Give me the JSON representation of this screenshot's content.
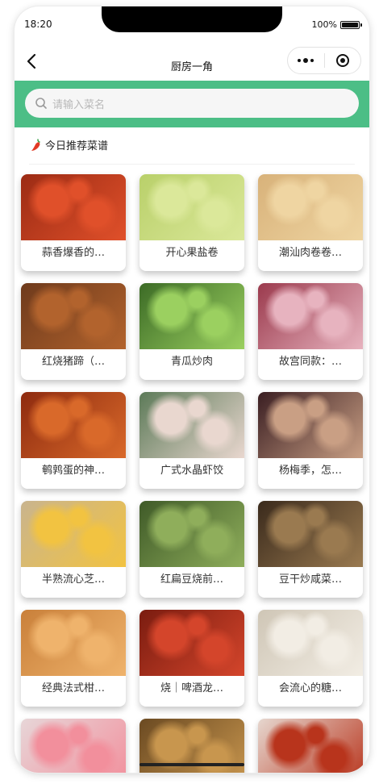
{
  "status": {
    "time": "18:20",
    "battery": "100%"
  },
  "nav": {
    "title": "厨房一角"
  },
  "search": {
    "placeholder": "请输入菜名"
  },
  "section": {
    "title": "今日推荐菜谱"
  },
  "colors": {
    "accent": "#4cbe86",
    "page_bg": "#ffffff"
  },
  "recipes": [
    {
      "label": "蒜香爆香的…",
      "bg": "#9b2b14",
      "accent": "#e0502a"
    },
    {
      "label": "开心果盐卷",
      "bg": "#b9d06a",
      "accent": "#dbe89a"
    },
    {
      "label": "潮汕肉卷卷…",
      "bg": "#d8b27a",
      "accent": "#efd5a2"
    },
    {
      "label": "红烧猪蹄（…",
      "bg": "#6e3a1c",
      "accent": "#b2632d"
    },
    {
      "label": "青瓜炒肉",
      "bg": "#3c6b26",
      "accent": "#9bd060"
    },
    {
      "label": "故宫同款：…",
      "bg": "#9b3a4d",
      "accent": "#e7b3bf"
    },
    {
      "label": "鹌鹑蛋的神…",
      "bg": "#8d2a0f",
      "accent": "#d9692a"
    },
    {
      "label": "广式水晶虾饺",
      "bg": "#5c7a58",
      "accent": "#e9d7cf"
    },
    {
      "label": "杨梅季，怎…",
      "bg": "#3a1e22",
      "accent": "#c99f84"
    },
    {
      "label": "半熟流心芝…",
      "bg": "#c9b48e",
      "accent": "#f2c341"
    },
    {
      "label": "红扁豆烧前…",
      "bg": "#3f5a28",
      "accent": "#8fae5b"
    },
    {
      "label": "豆干炒咸菜…",
      "bg": "#3a2a1c",
      "accent": "#9a7a50"
    },
    {
      "label": "经典法式柑…",
      "bg": "#c9803a",
      "accent": "#efb36c"
    },
    {
      "label": "烧｜啤酒龙…",
      "bg": "#7a1c10",
      "accent": "#d4452b"
    },
    {
      "label": "会流心的糖…",
      "bg": "#cfc6b6",
      "accent": "#f2ede4"
    },
    {
      "label": "",
      "bg": "#e7d6d8",
      "accent": "#f28f9c"
    },
    {
      "label": "",
      "bg": "#6b4a22",
      "accent": "#c8964e"
    },
    {
      "label": "",
      "bg": "#e6d7cf",
      "accent": "#b8341c"
    }
  ]
}
